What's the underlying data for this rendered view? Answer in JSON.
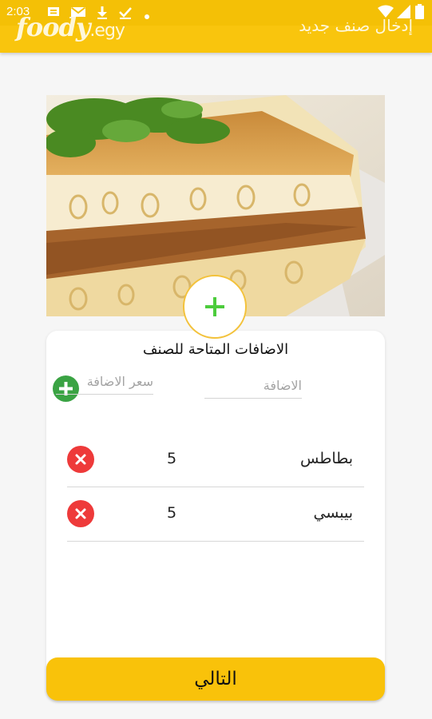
{
  "status_bar": {
    "time": "2:03",
    "icons": [
      "message-icon",
      "mail-icon",
      "download-icon",
      "check-icon",
      "dot-icon",
      "wifi-icon",
      "signal-icon",
      "battery-icon"
    ]
  },
  "header": {
    "logo_main": "foody",
    "logo_suffix": ".egy",
    "title": "إدخال صنف جديد"
  },
  "image": {
    "alt": "صورة الصنف",
    "add_icon": "plus-icon"
  },
  "addons": {
    "title": "الاضافات المتاحة للصنف",
    "name_placeholder": "الاضافة",
    "price_placeholder": "سعر الاضافة",
    "add_icon": "plus-circle-icon",
    "items": [
      {
        "name": "بطاطس",
        "price": "5",
        "remove_icon": "remove-icon"
      },
      {
        "name": "بيبسي",
        "price": "5",
        "remove_icon": "remove-icon"
      }
    ]
  },
  "actions": {
    "next_label": "التالي"
  },
  "colors": {
    "accent": "#f9c20a",
    "add_green": "#3aa343",
    "plus_green": "#4ccc3c",
    "delete_red": "#ee3a3a"
  }
}
